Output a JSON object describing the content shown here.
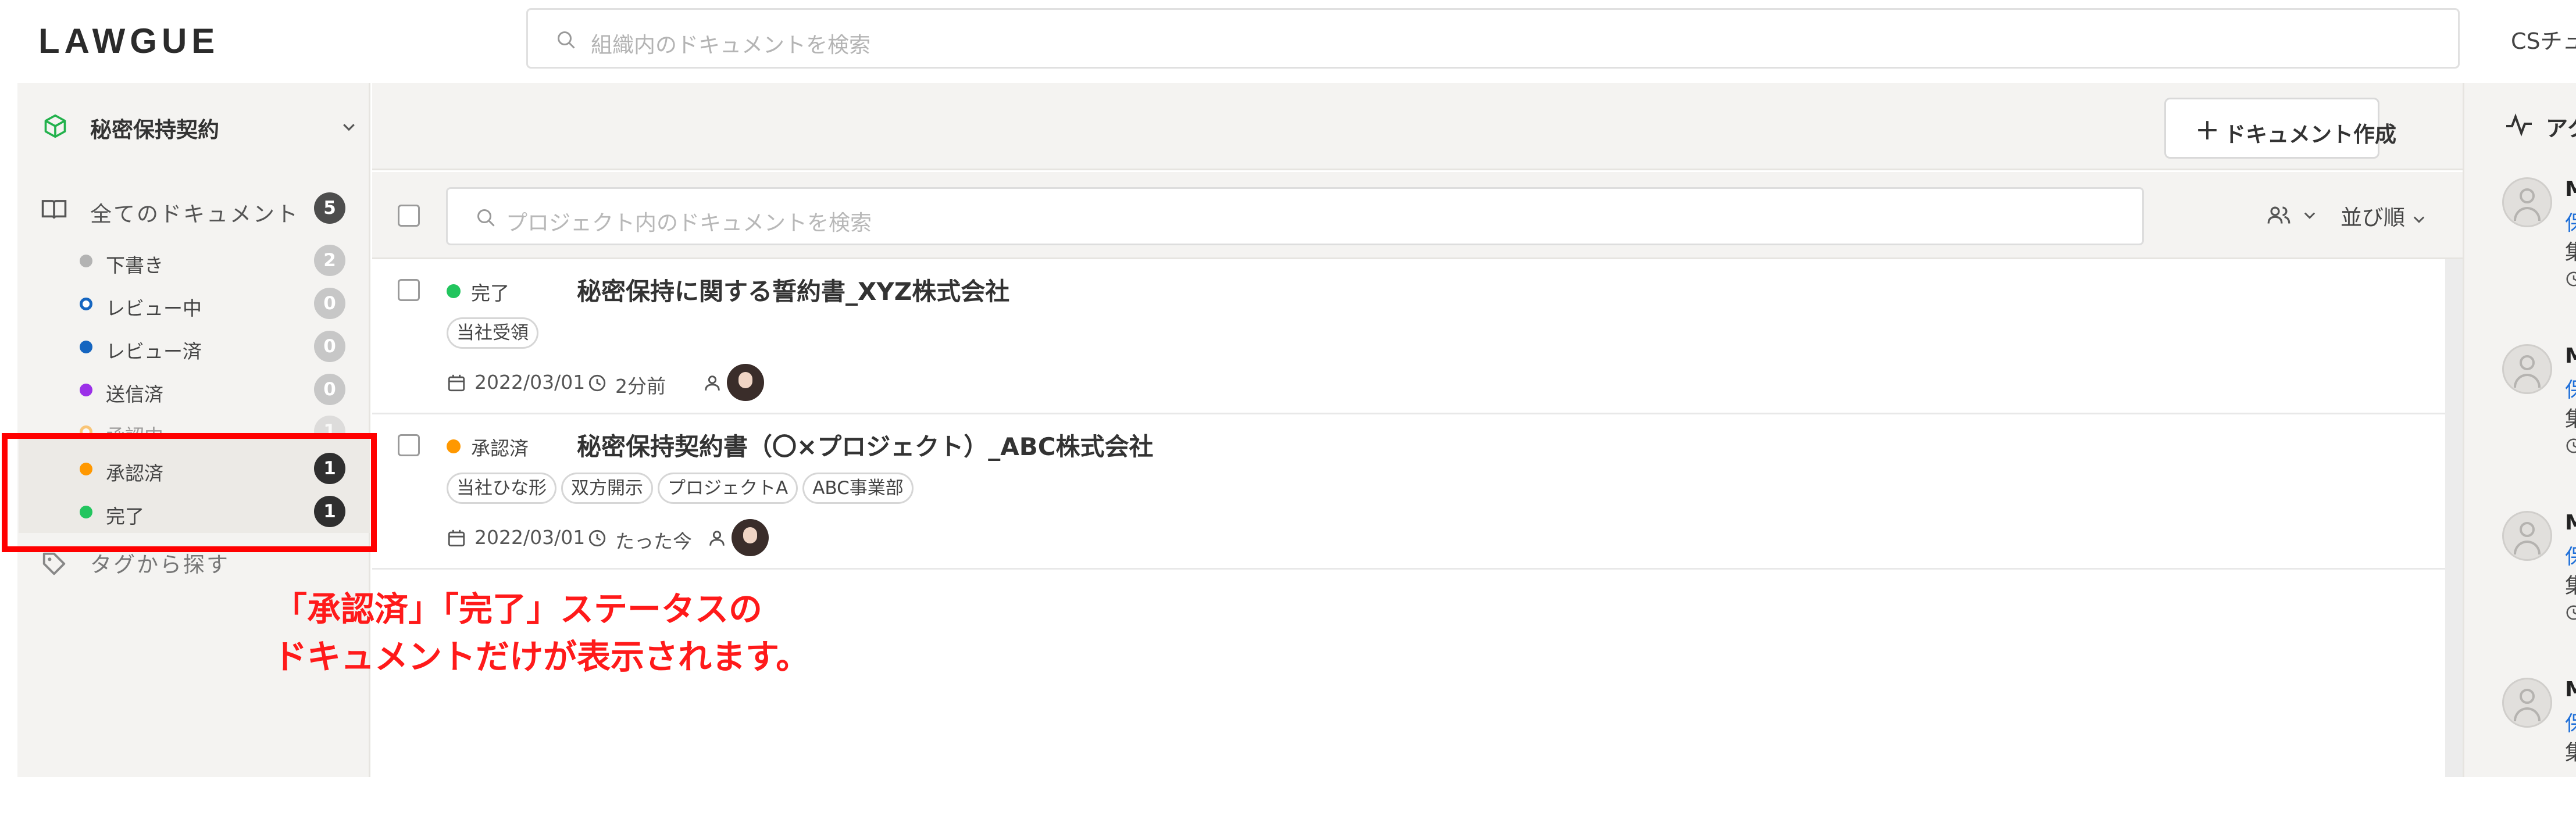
{
  "app": {
    "logo": "LAWGUE"
  },
  "header": {
    "search_placeholder": "組織内のドキュメントを検索",
    "user_label": "CSチュ"
  },
  "sidebar": {
    "project_name": "秘密保持契約",
    "all_docs": {
      "label": "全てのドキュメント",
      "count": "5"
    },
    "statuses": [
      {
        "label": "下書き",
        "count": "2",
        "color": "#b3b3b3"
      },
      {
        "label": "レビュー中",
        "count": "0",
        "color": "#1565c0"
      },
      {
        "label": "レビュー済",
        "count": "0",
        "color": "#1565c0"
      },
      {
        "label": "送信済",
        "count": "0",
        "color": "#9b30e8"
      },
      {
        "label": "承認中",
        "count": "1",
        "color": "#ff9800"
      },
      {
        "label": "承認済",
        "count": "1",
        "color": "#ff9800"
      },
      {
        "label": "完了",
        "count": "1",
        "color": "#22c55e"
      }
    ],
    "tag_search": "タグから探す"
  },
  "annotation": {
    "line1": "「承認済」「完了」ステータスの",
    "line2": "ドキュメントだけが表示されます。",
    "color": "#ff0000"
  },
  "toolbar": {
    "create_label": "ドキュメント作成"
  },
  "filter": {
    "search_placeholder": "プロジェクト内のドキュメントを検索",
    "sort_label": "並び順"
  },
  "documents": [
    {
      "status": "完了",
      "status_color": "#22c55e",
      "title": "秘密保持に関する誓約書_XYZ株式会社",
      "tags": [
        "当社受領"
      ],
      "date": "2022/03/01",
      "updated": "2分前"
    },
    {
      "status": "承認済",
      "status_color": "#ff9800",
      "title": "秘密保持契約書（〇×プロジェクト）_ABC株式会社",
      "tags": [
        "当社ひな形",
        "双方開示",
        "プロジェクトA",
        "ABC事業部"
      ],
      "date": "2022/03/01",
      "updated": "たった今"
    }
  ],
  "activity": {
    "header": "アク",
    "items": [
      {
        "user": "M",
        "link": "保",
        "text": "集"
      },
      {
        "user": "M",
        "link": "保",
        "text": "集"
      },
      {
        "user": "M",
        "link": "保",
        "text": "集"
      },
      {
        "user": "M",
        "link": "保",
        "text": "集"
      }
    ]
  }
}
